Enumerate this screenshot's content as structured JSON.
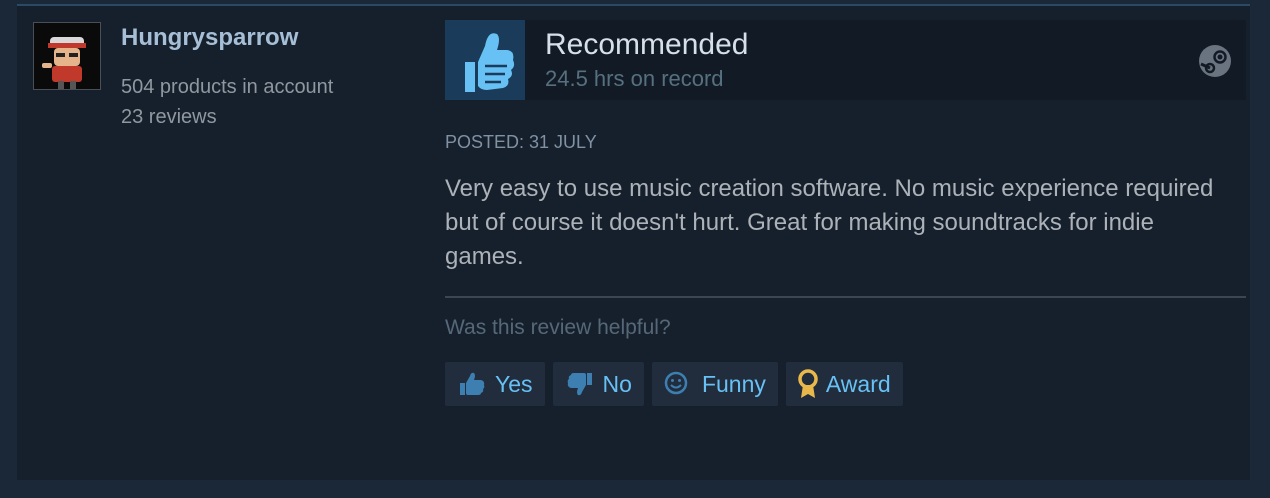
{
  "author": {
    "name": "Hungrysparrow",
    "products": "504 products in account",
    "reviews": "23 reviews"
  },
  "recommendation": {
    "label": "Recommended",
    "hours": "24.5 hrs on record",
    "thumb_icon": "thumbs-up-icon",
    "platform_icon": "steam-icon"
  },
  "posted": "POSTED: 31 JULY",
  "review_text": "Very easy to use music creation software. No music experience required but of course it doesn't hurt. Great for making soundtracks for indie games.",
  "helpful_question": "Was this review helpful?",
  "buttons": {
    "yes": "Yes",
    "no": "No",
    "funny": "Funny",
    "award": "Award"
  },
  "colors": {
    "background": "#1b2838",
    "card": "#16202d",
    "accent": "#67c1f5",
    "thumb": "#67c1f5",
    "award": "#e8b94a"
  }
}
